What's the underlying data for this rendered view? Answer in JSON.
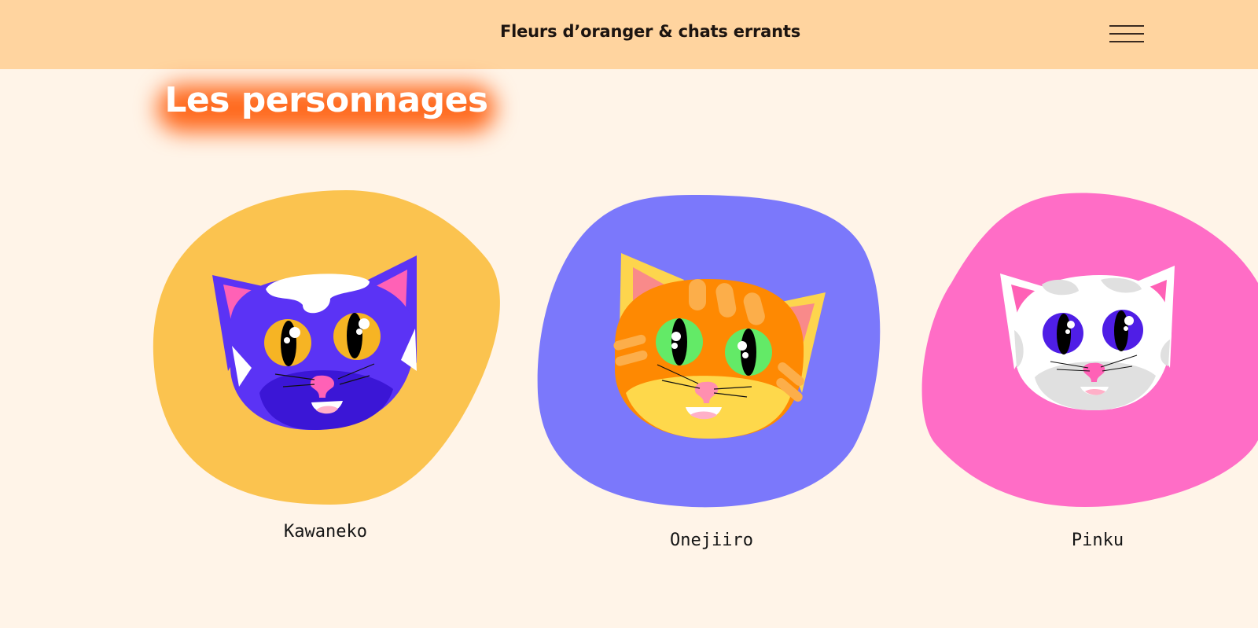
{
  "header": {
    "title": "Fleurs d’oranger & chats errants",
    "menu_icon": "hamburger-menu-icon"
  },
  "section": {
    "title": "Les personnages"
  },
  "characters": [
    {
      "name": "Kawaneko",
      "blob_color": "#fbc34f",
      "fur_color": "#5b33f5",
      "eye_color": "#f6b424"
    },
    {
      "name": "Onejiiro",
      "blob_color": "#7b78fb",
      "fur_color": "#fe8902",
      "eye_color": "#63ea67"
    },
    {
      "name": "Pinku",
      "blob_color": "#ff6dc6",
      "fur_color": "#ffffff",
      "eye_color": "#4f1ee6"
    }
  ]
}
